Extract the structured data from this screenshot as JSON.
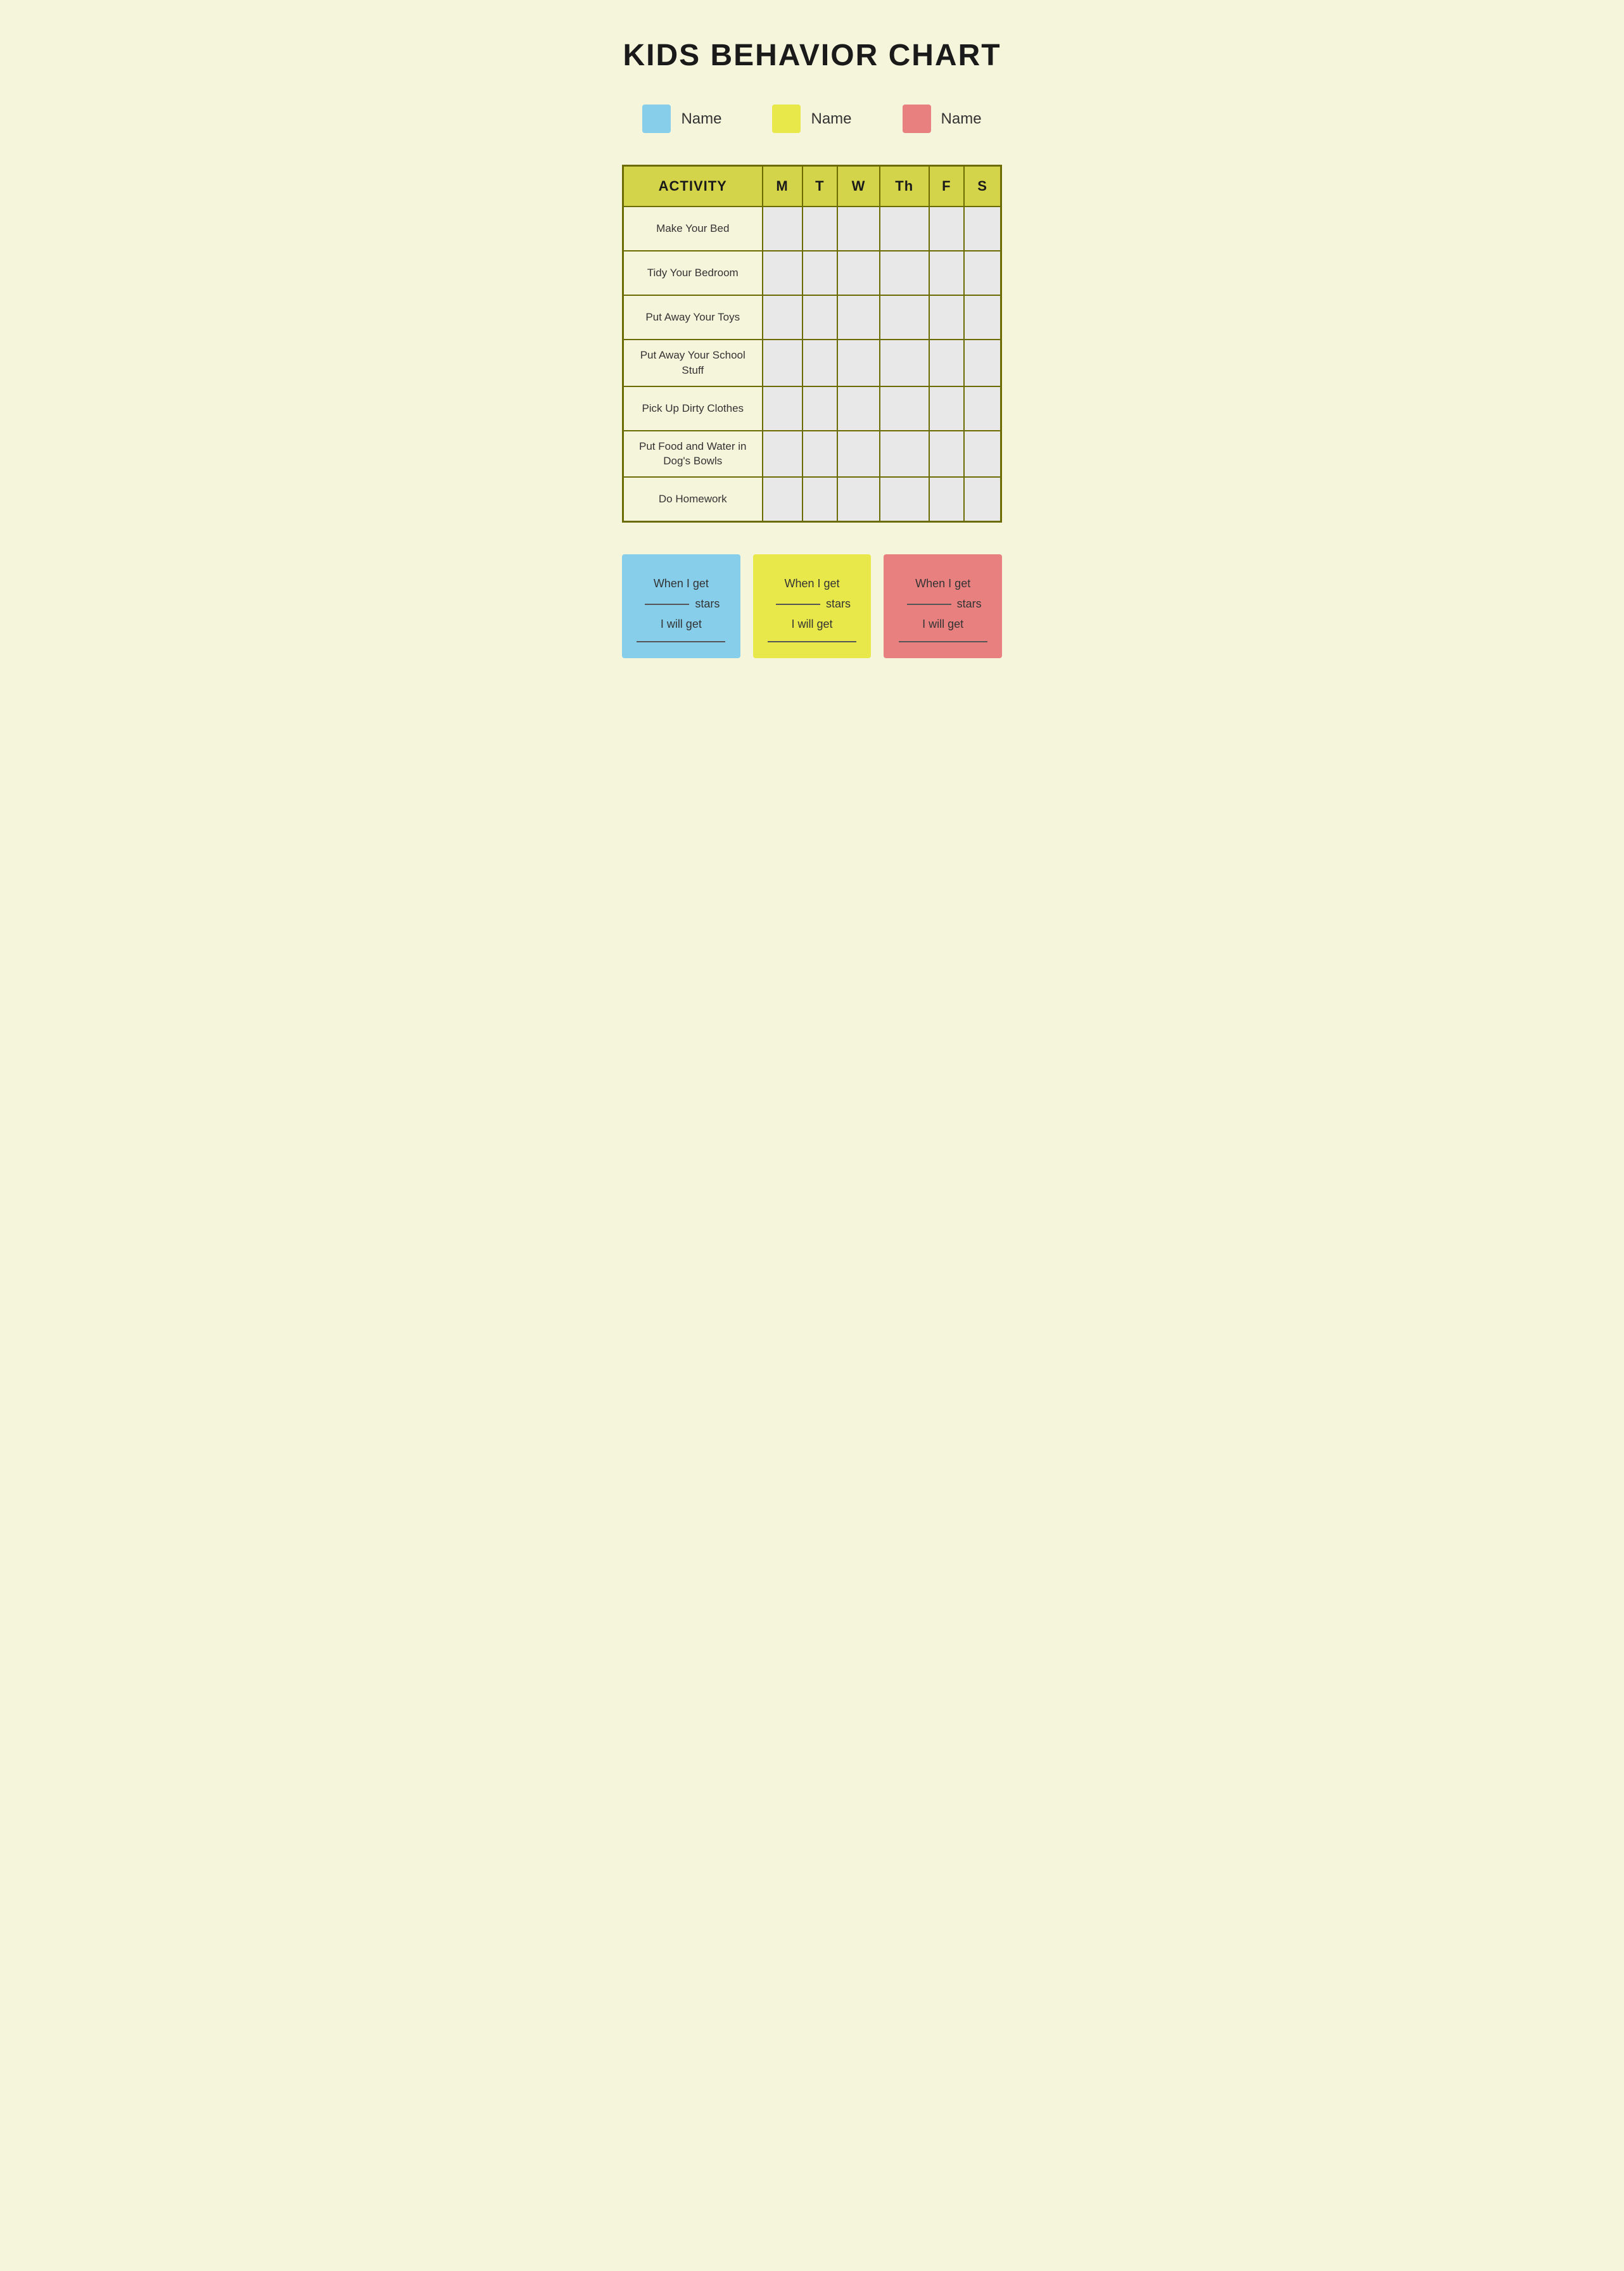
{
  "page": {
    "title": "KIDS BEHAVIOR CHART",
    "background_color": "#f5f5dc"
  },
  "legend": {
    "items": [
      {
        "id": "blue",
        "color": "#87CEEB",
        "label": "Name"
      },
      {
        "id": "yellow",
        "color": "#e8e84a",
        "label": "Name"
      },
      {
        "id": "pink",
        "color": "#e88080",
        "label": "Name"
      }
    ]
  },
  "table": {
    "header": {
      "activity": "ACTIVITY",
      "days": [
        "M",
        "T",
        "W",
        "Th",
        "F",
        "S"
      ]
    },
    "rows": [
      {
        "id": 1,
        "activity": "Make Your Bed"
      },
      {
        "id": 2,
        "activity": "Tidy Your Bedroom"
      },
      {
        "id": 3,
        "activity": "Put Away Your Toys"
      },
      {
        "id": 4,
        "activity": "Put Away Your School Stuff"
      },
      {
        "id": 5,
        "activity": "Pick Up Dirty Clothes"
      },
      {
        "id": 6,
        "activity": "Put Food and Water in Dog's Bowls"
      },
      {
        "id": 7,
        "activity": "Do Homework"
      }
    ]
  },
  "rewards": [
    {
      "id": "blue",
      "bg_color": "#87CEEB",
      "line1": "When I get",
      "line2": "stars",
      "line3": "I will get"
    },
    {
      "id": "yellow",
      "bg_color": "#e8e84a",
      "line1": "When I get",
      "line2": "stars",
      "line3": "I will get"
    },
    {
      "id": "pink",
      "bg_color": "#e88080",
      "line1": "When I get",
      "line2": "stars",
      "line3": "I will get"
    }
  ]
}
